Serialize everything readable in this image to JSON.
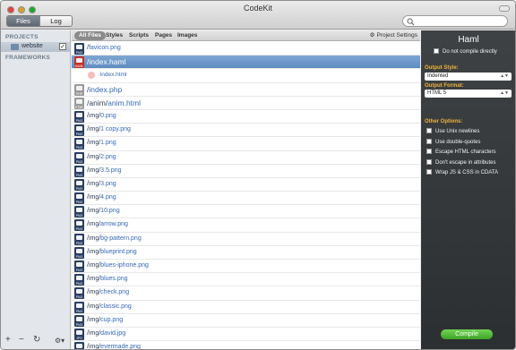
{
  "window": {
    "title": "CodeKit"
  },
  "toolbar": {
    "tabs": [
      {
        "label": "Files"
      },
      {
        "label": "Log"
      }
    ],
    "search_placeholder": ""
  },
  "sidebar": {
    "projects_heading": "PROJECTS",
    "project_name": "website",
    "project_checked": "✓",
    "frameworks_heading": "FRAMEWORKS",
    "bottom": {
      "add": "+",
      "remove": "−",
      "refresh": "↻",
      "gear": "⚙▾"
    }
  },
  "filters": {
    "items": [
      "All Files",
      "Styles",
      "Scripts",
      "Pages",
      "Images"
    ],
    "project_settings": "Project Settings"
  },
  "files": [
    {
      "dir": "/",
      "name": "favicon.png",
      "icon": "PNG",
      "kind": "png"
    },
    {
      "dir": "/",
      "name": "index.haml",
      "icon": "HAML",
      "kind": "haml",
      "selected": true
    },
    {
      "dir": "/",
      "name": "index.html",
      "icon": "",
      "kind": "child"
    },
    {
      "dir": "/",
      "name": "index.php",
      "icon": "PHP",
      "kind": "php"
    },
    {
      "dir": "/anim/",
      "name": "anim.html",
      "icon": "HTML",
      "kind": "html"
    },
    {
      "dir": "/img/",
      "name": "0.png",
      "icon": "PNG",
      "kind": "png"
    },
    {
      "dir": "/img/",
      "name": "1 copy.png",
      "icon": "PNG",
      "kind": "png"
    },
    {
      "dir": "/img/",
      "name": "1.png",
      "icon": "PNG",
      "kind": "png"
    },
    {
      "dir": "/img/",
      "name": "2.png",
      "icon": "PNG",
      "kind": "png"
    },
    {
      "dir": "/img/",
      "name": "3.5.png",
      "icon": "PNG",
      "kind": "png"
    },
    {
      "dir": "/img/",
      "name": "3.png",
      "icon": "PNG",
      "kind": "png"
    },
    {
      "dir": "/img/",
      "name": "4.png",
      "icon": "PNG",
      "kind": "png"
    },
    {
      "dir": "/img/",
      "name": "10.png",
      "icon": "PNG",
      "kind": "png"
    },
    {
      "dir": "/img/",
      "name": "arrow.png",
      "icon": "PNG",
      "kind": "png"
    },
    {
      "dir": "/img/",
      "name": "bg-pattern.png",
      "icon": "PNG",
      "kind": "png"
    },
    {
      "dir": "/img/",
      "name": "blueprint.png",
      "icon": "PNG",
      "kind": "png"
    },
    {
      "dir": "/img/",
      "name": "blues-iphone.png",
      "icon": "PNG",
      "kind": "png"
    },
    {
      "dir": "/img/",
      "name": "blues.png",
      "icon": "PNG",
      "kind": "png"
    },
    {
      "dir": "/img/",
      "name": "check.png",
      "icon": "PNG",
      "kind": "png"
    },
    {
      "dir": "/img/",
      "name": "classic.png",
      "icon": "PNG",
      "kind": "png"
    },
    {
      "dir": "/img/",
      "name": "cup.png",
      "icon": "PNG",
      "kind": "png"
    },
    {
      "dir": "/img/",
      "name": "david.jpg",
      "icon": "JPG",
      "kind": "png"
    },
    {
      "dir": "/img/",
      "name": "evermade.png",
      "icon": "PNG",
      "kind": "png"
    }
  ],
  "panel": {
    "title": "Haml",
    "do_not_compile": "Do not compile directly",
    "output_style_label": "Output Style:",
    "output_style_value": "Indented",
    "output_format_label": "Output Format:",
    "output_format_value": "HTML 5",
    "other_options_label": "Other Options:",
    "options": [
      "Use Unix newlines",
      "Use double-quotes",
      "Escape HTML characters",
      "Don't escape in attributes",
      "Wrap JS & CSS in CDATA"
    ],
    "compile_label": "Compile"
  },
  "colors": {
    "selection": "#6f99cb",
    "panel_bg": "#323537",
    "option_label": "#f0b13c",
    "compile_green": "#4dba32"
  }
}
